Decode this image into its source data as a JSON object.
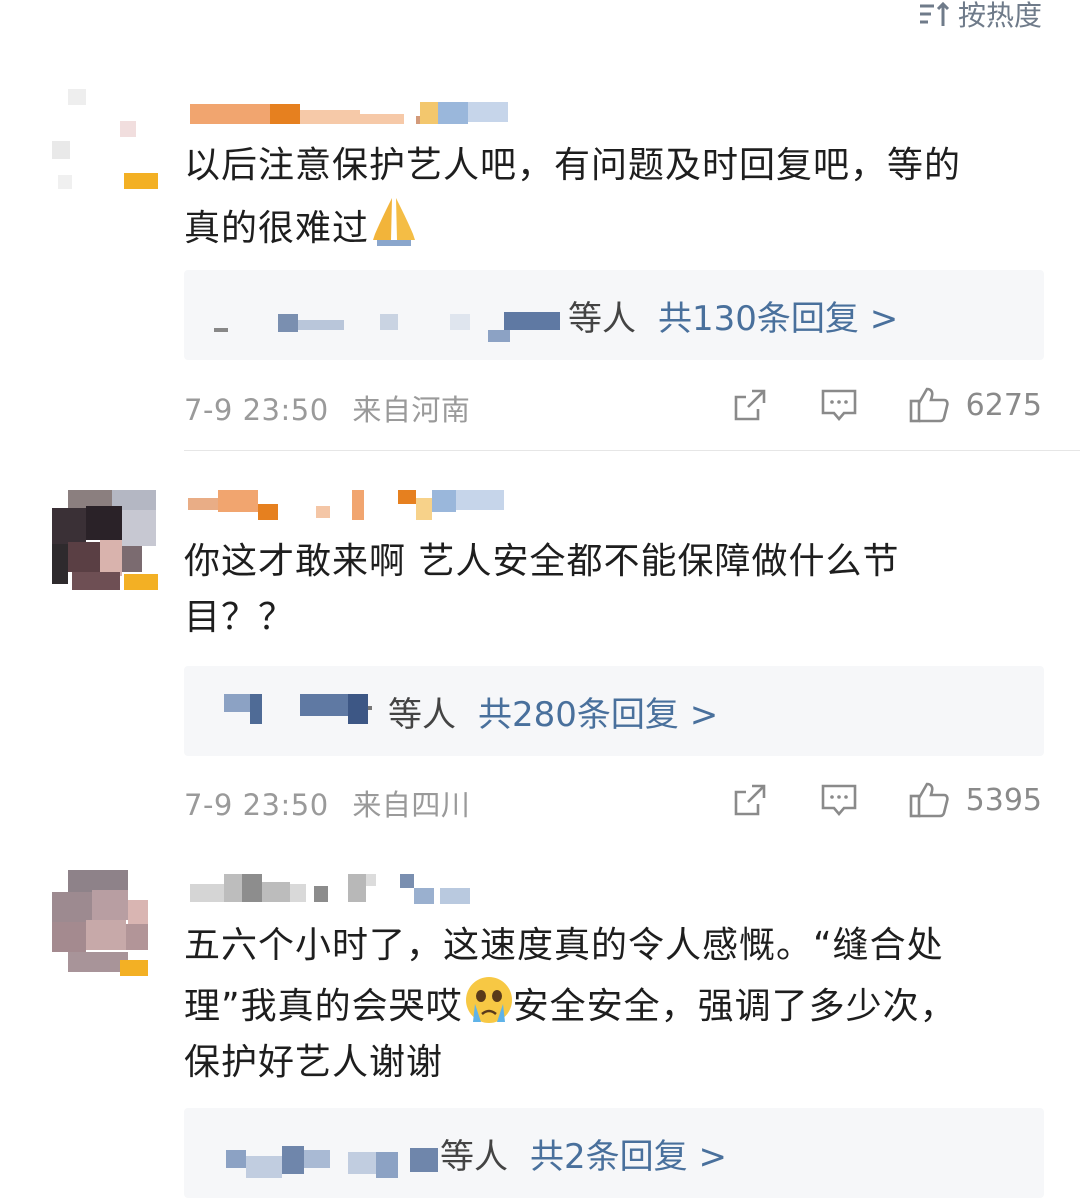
{
  "header": {
    "sort_label": "按热度"
  },
  "comments": [
    {
      "text_line1": "以后注意保护艺人吧，有问题及时回复吧，等的",
      "text_line2": "真的很难过",
      "replies_who": "等人",
      "replies_total": "共130条回复 >",
      "time": "7-9 23:50",
      "location": "来自河南",
      "likes": "6275"
    },
    {
      "text_line1": "你这才敢来啊 艺人安全都不能保障做什么节",
      "text_line2": "目？？",
      "replies_who": "等人",
      "replies_total": "共280条回复 >",
      "time": "7-9 23:50",
      "location": "来自四川",
      "likes": "5395"
    },
    {
      "text_line1": "五六个小时了，这速度真的令人感慨。“缝合处",
      "text_line2a": "理”我真的会哭哎",
      "text_line2b": "安全安全，强调了多少次，",
      "text_line3": "保护好艺人谢谢",
      "replies_who": "等人",
      "replies_total": "共2条回复 >"
    }
  ],
  "icons": {
    "sort": "sort-icon",
    "share": "share-icon",
    "comment": "comment-icon",
    "like": "thumbs-up-icon",
    "pray": "praying-hands-emoji",
    "cry": "crying-face-emoji"
  },
  "colors": {
    "link": "#49709c",
    "meta": "#9a9a9a",
    "reply_bg": "#f6f7f9"
  }
}
